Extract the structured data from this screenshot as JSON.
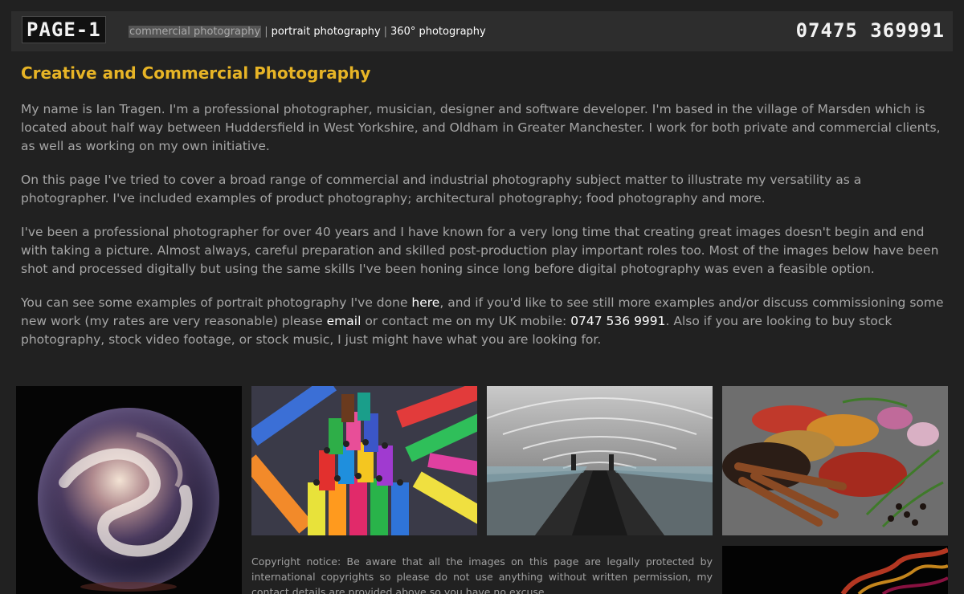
{
  "header": {
    "logo": "PAGE-1",
    "nav": [
      {
        "label": "commercial photography",
        "active": true
      },
      {
        "label": "portrait photography",
        "active": false
      },
      {
        "label": "360° photography",
        "active": false
      }
    ],
    "nav_separator": "|",
    "phone": "07475 369991"
  },
  "main": {
    "title": "Creative and Commercial Photography",
    "p1": "My name is Ian Tragen. I'm a professional photographer, musician, designer and software developer. I'm based in the village of Marsden which is located about half way between Huddersfield in West Yorkshire, and Oldham in Greater Manchester. I work for both private and commercial clients, as well as working on my own initiative.",
    "p2": "On this page I've tried to cover a broad range of commercial and industrial photography subject matter to illustrate my versatility as a photographer. I've included examples of product photography; architectural photography; food photography and more.",
    "p3": "I've been a professional photographer for over 40 years and I have known for a very long time that creating great images doesn't begin and end with taking a picture. Almost always, careful preparation and skilled post-production play important roles too. Most of the images below have been shot and processed digitally but using the same skills I've been honing since long before digital photography was even a feasible option.",
    "p4": {
      "t1": "You can see some examples of portrait photography I've done ",
      "link_here": "here",
      "t2": ", and if you'd like to see still more examples and/or discuss commissioning some new work (my rates are very reasonable) please ",
      "link_email": "email",
      "t3": " or contact me on my UK mobile: ",
      "link_phone": "0747 536 9991",
      "t4": ". Also if you are looking to buy stock photography, stock video footage, or stock music, I just might have what you are looking for."
    }
  },
  "gallery": {
    "images": [
      {
        "name": "glass-sphere-photo"
      },
      {
        "name": "felt-tip-pens-photo"
      },
      {
        "name": "moving-walkway-tunnel-photo"
      },
      {
        "name": "spices-photo"
      },
      {
        "name": "smoke-photo"
      }
    ],
    "copyright": "Copyright notice: Be aware that all the images on this page are legally protected by international copyrights so please do not use anything without written permission, my contact details are provided above so you have no excuse."
  },
  "colors": {
    "background": "#212121",
    "header_bg": "#2d2d2d",
    "title": "#e7b426",
    "body_text": "#a6a6a6",
    "link": "#ffffff"
  }
}
